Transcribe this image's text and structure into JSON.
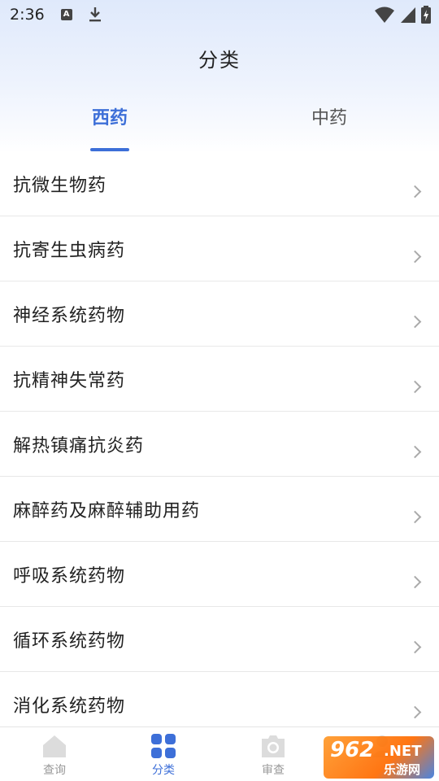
{
  "status_bar": {
    "time": "2:36",
    "a_icon_label": "A"
  },
  "header": {
    "title": "分类"
  },
  "tabs": [
    {
      "label": "西药",
      "active": true
    },
    {
      "label": "中药",
      "active": false
    }
  ],
  "categories": [
    {
      "label": "抗微生物药"
    },
    {
      "label": "抗寄生虫病药"
    },
    {
      "label": "神经系统药物"
    },
    {
      "label": "抗精神失常药"
    },
    {
      "label": "解热镇痛抗炎药"
    },
    {
      "label": "麻醉药及麻醉辅助用药"
    },
    {
      "label": "呼吸系统药物"
    },
    {
      "label": "循环系统药物"
    },
    {
      "label": "消化系统药物"
    }
  ],
  "bottom_nav": [
    {
      "label": "查询",
      "icon": "home-icon",
      "active": false
    },
    {
      "label": "分类",
      "icon": "grid-icon",
      "active": true
    },
    {
      "label": "审查",
      "icon": "camera-icon",
      "active": false
    },
    {
      "label": "",
      "icon": "profile-icon",
      "active": false
    }
  ],
  "watermark": {
    "number": "962",
    "suffix": ".NET",
    "subtitle": "乐游网"
  },
  "colors": {
    "accent": "#3d6fd8",
    "inactive": "#999999",
    "divider": "#e8e8e8"
  }
}
